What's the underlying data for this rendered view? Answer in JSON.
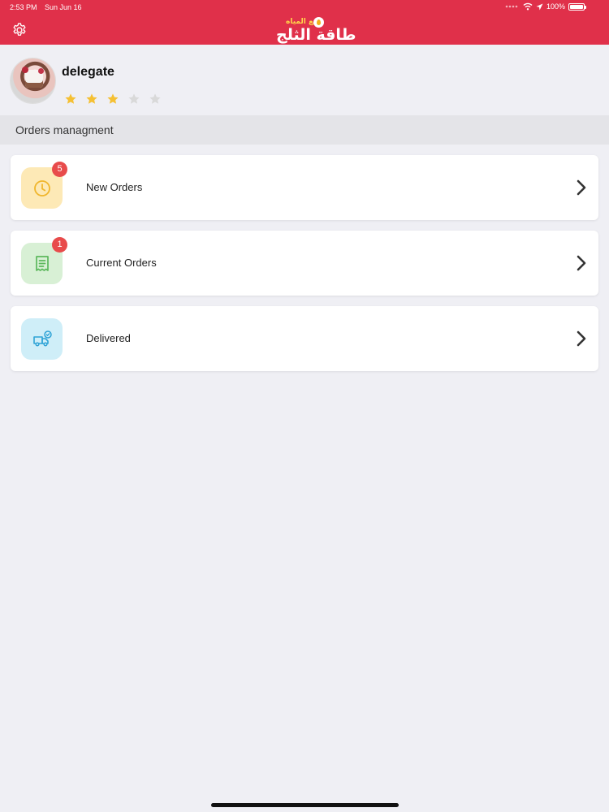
{
  "status_bar": {
    "time": "2:53 PM",
    "date": "Sun Jun 16",
    "battery": "100%"
  },
  "header": {
    "logo_main": "طاقة الثلج",
    "logo_sub": "لبيع المياه",
    "background_color": "#e0304a"
  },
  "profile": {
    "name": "delegate",
    "rating": 3,
    "rating_max": 5,
    "star_color_filled": "#f5c033",
    "star_color_empty": "#d9d9d9"
  },
  "section": {
    "title": "Orders managment"
  },
  "orders": [
    {
      "label": "New Orders",
      "badge": "5",
      "icon": "clock-icon",
      "icon_bg": "#fde9b6",
      "icon_color": "#f0b62d"
    },
    {
      "label": "Current Orders",
      "badge": "1",
      "icon": "receipt-icon",
      "icon_bg": "#d8f0d5",
      "icon_color": "#5cb85c"
    },
    {
      "label": "Delivered",
      "badge": "",
      "icon": "truck-check-icon",
      "icon_bg": "#cfeef8",
      "icon_color": "#2fa3d6"
    }
  ]
}
